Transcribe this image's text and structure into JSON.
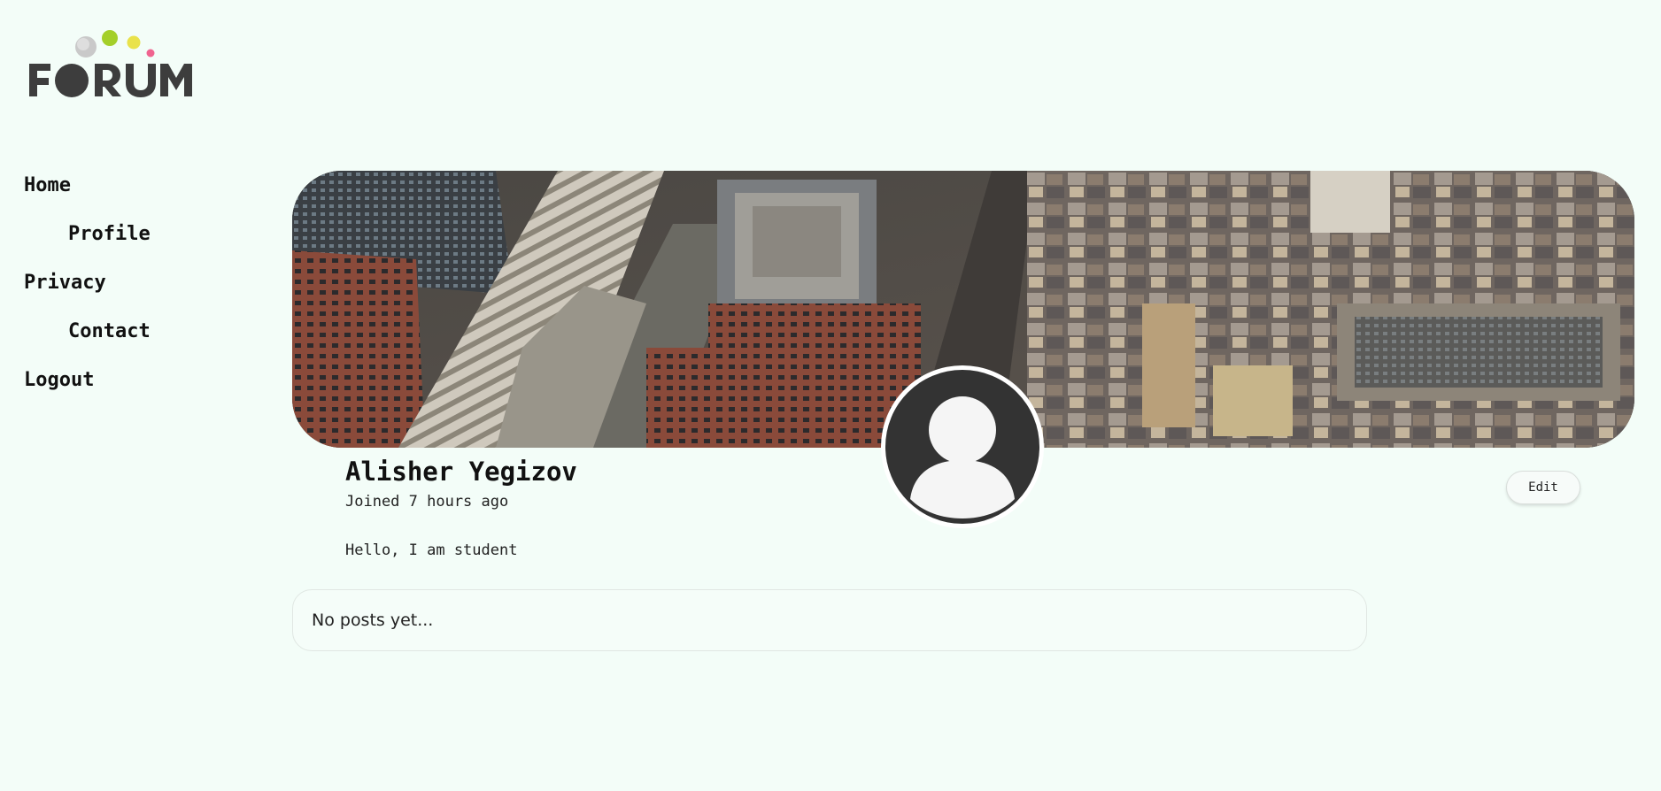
{
  "logo": {
    "text": "FORUM",
    "dot_colors": [
      "#c8c8c8",
      "#9acd32",
      "#e8e34a",
      "#f06292"
    ]
  },
  "nav": {
    "items": [
      {
        "label": "Home"
      },
      {
        "label": "Profile"
      },
      {
        "label": "Privacy"
      },
      {
        "label": "Contact"
      },
      {
        "label": "Logout"
      }
    ]
  },
  "profile": {
    "name": "Alisher Yegizov",
    "joined": "Joined 7 hours ago",
    "bio": "Hello, I am student",
    "edit_label": "Edit",
    "avatar_icon": "user-avatar-icon"
  },
  "posts": {
    "empty_text": "No posts yet..."
  },
  "colors": {
    "background": "#f3fdf8",
    "text": "#111111",
    "avatar": "#333333"
  }
}
